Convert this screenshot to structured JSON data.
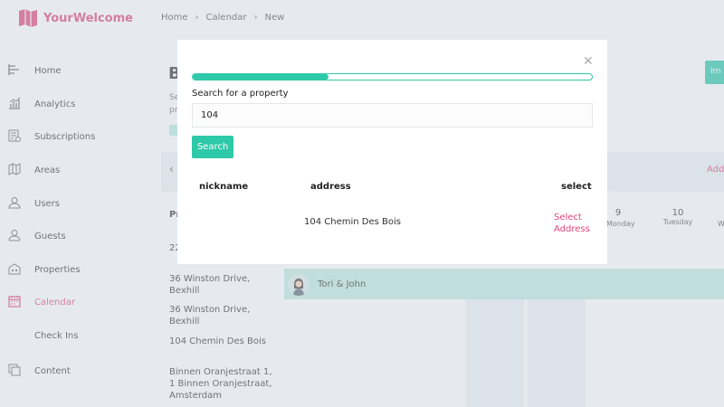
{
  "app": {
    "brand": "YourWelcome",
    "brand_color": "#e0457b",
    "accent_color": "#2dc9a8",
    "logo_icon": "map-book-icon"
  },
  "breadcrumb": [
    "Home",
    "Calendar",
    "New"
  ],
  "sidebar": {
    "items": [
      {
        "label": "Home",
        "icon": "home-icon"
      },
      {
        "label": "Analytics",
        "icon": "analytics-icon"
      },
      {
        "label": "Subscriptions",
        "icon": "subscriptions-icon"
      },
      {
        "label": "Areas",
        "icon": "map-icon"
      },
      {
        "label": "Users",
        "icon": "user-icon"
      },
      {
        "label": "Guests",
        "icon": "guest-icon"
      },
      {
        "label": "Properties",
        "icon": "building-icon"
      },
      {
        "label": "Calendar",
        "icon": "calendar-icon",
        "active": true
      },
      {
        "label": "Check Ins",
        "icon": ""
      },
      {
        "label": "Content",
        "icon": "content-icon"
      }
    ]
  },
  "background": {
    "title_fragment": "B",
    "desc_fragments": [
      "Se",
      "pr"
    ],
    "import_fragment": "Im",
    "add_fragment": "Add",
    "prev_icon": "chevron-left-icon",
    "row_header_fragment": "Pr",
    "columns": [
      {
        "num": "",
        "day": "Monday"
      },
      {
        "num": "9",
        "day": ""
      },
      {
        "num": "10",
        "day": "Tuesday"
      }
    ],
    "col_frag_w": "W",
    "properties": [
      "22",
      "36 Winston Drive, Bexhill",
      "36 Winston Drive, Bexhill",
      "104 Chemin Des Bois",
      "Binnen Oranjestraat 1, 1 Binnen Oranjestraat, Amsterdam"
    ],
    "booking": {
      "name": "Tori & John"
    }
  },
  "modal": {
    "close_icon": "close-icon",
    "progress": 0.34,
    "search_label": "Search for a property",
    "search_value": "104",
    "search_button": "Search",
    "columns": {
      "nickname": "nickname",
      "address": "address",
      "select": "select"
    },
    "results": [
      {
        "nickname": "",
        "address": "104 Chemin Des Bois",
        "select": "Select Address"
      }
    ]
  }
}
